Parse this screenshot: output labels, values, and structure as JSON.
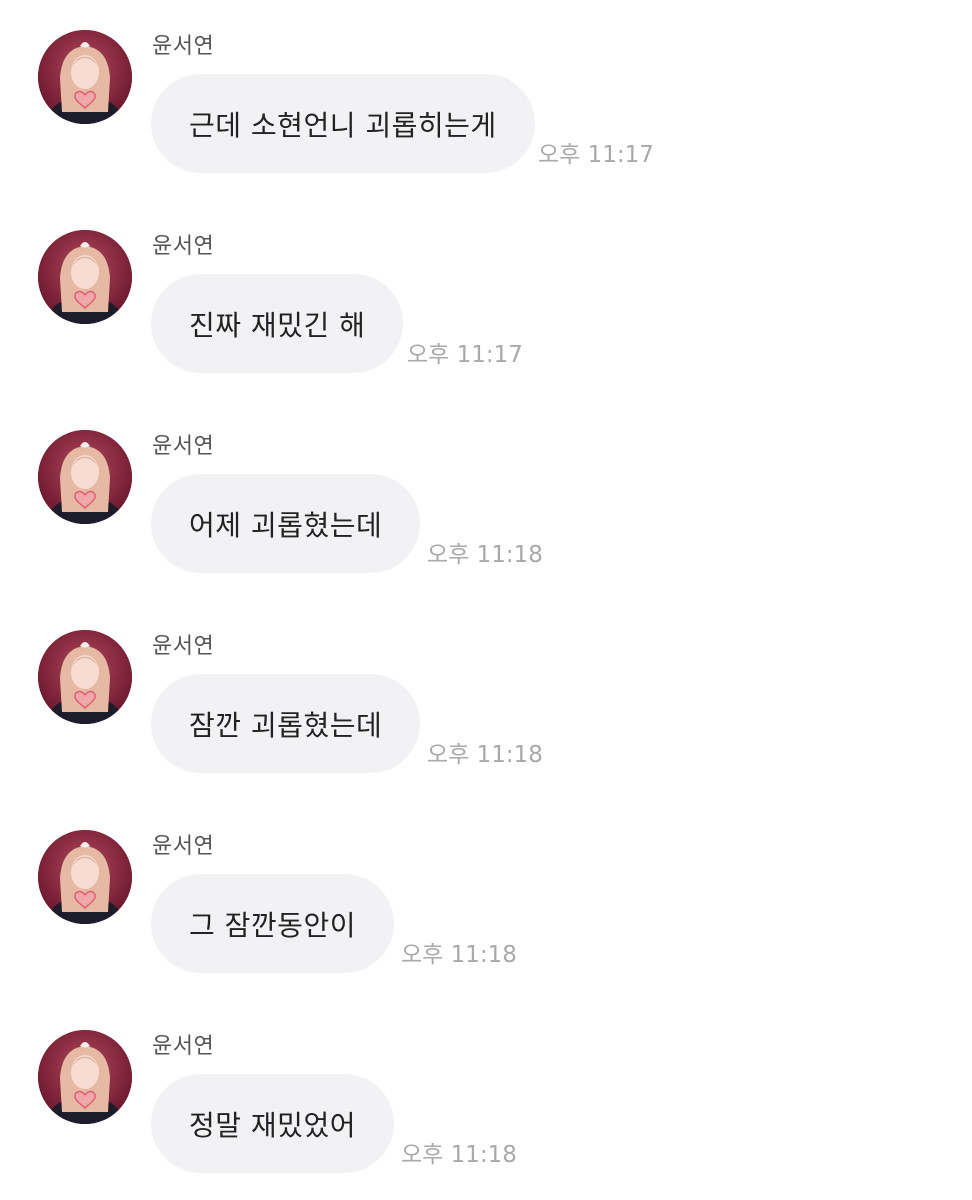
{
  "messages": [
    {
      "sender": "윤서연",
      "text": "근데 소현언니 괴롭히는게",
      "time": "오후 11:17"
    },
    {
      "sender": "윤서연",
      "text": "진짜 재밌긴 해",
      "time": "오후 11:17"
    },
    {
      "sender": "윤서연",
      "text": "어제 괴롭혔는데",
      "time": "오후 11:18"
    },
    {
      "sender": "윤서연",
      "text": "잠깐 괴롭혔는데",
      "time": "오후 11:18"
    },
    {
      "sender": "윤서연",
      "text": "그 잠깐동안이",
      "time": "오후 11:18"
    },
    {
      "sender": "윤서연",
      "text": "정말 재밌었어",
      "time": "오후 11:18"
    }
  ],
  "avatar_icon": "profile-photo-icon",
  "colors": {
    "bubble": "#f2f2f4",
    "text": "#222222",
    "sender": "#555555",
    "time": "#a9a9ad",
    "avatar_bg": "#7a1830"
  }
}
